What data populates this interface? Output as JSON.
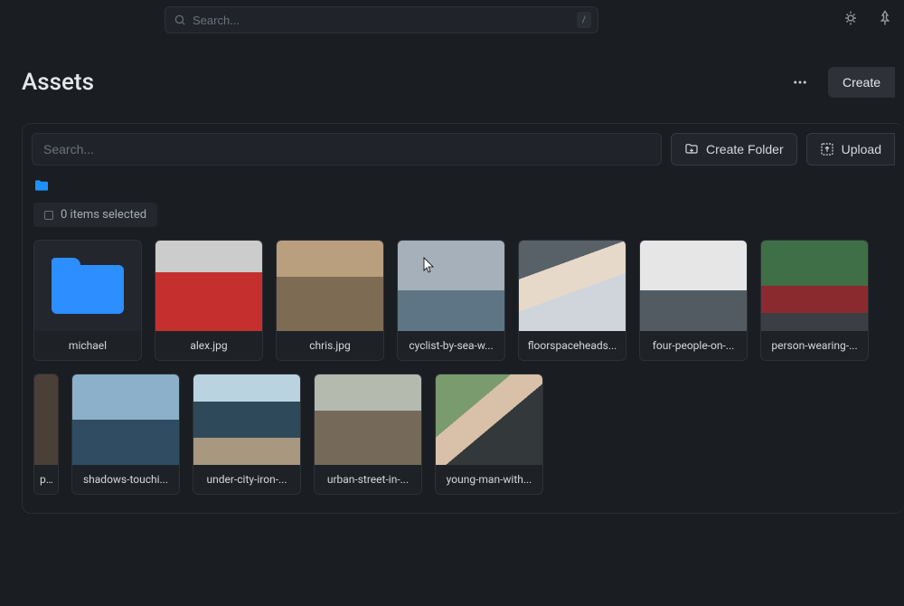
{
  "topbar": {
    "search_placeholder": "Search...",
    "shortcut_key": "/"
  },
  "page": {
    "title": "Assets",
    "create_label": "Create"
  },
  "panel": {
    "search_placeholder": "Search...",
    "create_folder_label": "Create Folder",
    "upload_label": "Upload",
    "selection_text": "0 items selected"
  },
  "assets": [
    {
      "name": "michael",
      "type": "folder"
    },
    {
      "name": "alex.jpg",
      "type": "image",
      "ph": "ph-alex"
    },
    {
      "name": "chris.jpg",
      "type": "image",
      "ph": "ph-chris"
    },
    {
      "name": "cyclist-by-sea-w...",
      "type": "image",
      "ph": "ph-cyclist",
      "cursor": true
    },
    {
      "name": "floorspaceheads...",
      "type": "image",
      "ph": "ph-floorspace"
    },
    {
      "name": "four-people-on-...",
      "type": "image",
      "ph": "ph-four"
    },
    {
      "name": "person-wearing-...",
      "type": "image",
      "ph": "ph-person"
    },
    {
      "name": "prof",
      "type": "image",
      "ph": "ph-prof",
      "partial": true
    },
    {
      "name": "shadows-touchi...",
      "type": "image",
      "ph": "ph-shadow"
    },
    {
      "name": "under-city-iron-...",
      "type": "image",
      "ph": "ph-under"
    },
    {
      "name": "urban-street-in-...",
      "type": "image",
      "ph": "ph-urban"
    },
    {
      "name": "young-man-with...",
      "type": "image",
      "ph": "ph-young"
    }
  ]
}
